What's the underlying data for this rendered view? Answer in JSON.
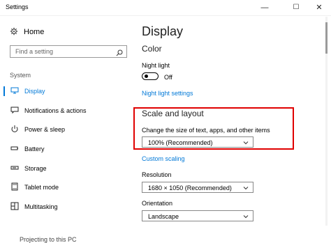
{
  "window": {
    "title": "Settings"
  },
  "sidebar": {
    "home_label": "Home",
    "search_placeholder": "Find a setting",
    "section_label": "System",
    "items": [
      {
        "label": "Display",
        "icon": "monitor-icon",
        "active": true
      },
      {
        "label": "Notifications & actions",
        "icon": "message-icon",
        "active": false
      },
      {
        "label": "Power & sleep",
        "icon": "power-icon",
        "active": false
      },
      {
        "label": "Battery",
        "icon": "battery-icon",
        "active": false
      },
      {
        "label": "Storage",
        "icon": "storage-icon",
        "active": false
      },
      {
        "label": "Tablet mode",
        "icon": "tablet-icon",
        "active": false
      },
      {
        "label": "Multitasking",
        "icon": "multitask-icon",
        "active": false
      }
    ],
    "cut_off_text": "Projecting to this PC"
  },
  "main": {
    "title": "Display",
    "color_heading": "Color",
    "night_light_label": "Night light",
    "night_light_state": "Off",
    "night_light_settings": "Night light settings",
    "scale_heading": "Scale and layout",
    "scale_description": "Change the size of text, apps, and other items",
    "scale_value": "100% (Recommended)",
    "custom_scaling": "Custom scaling",
    "resolution_label": "Resolution",
    "resolution_value": "1680 × 1050 (Recommended)",
    "orientation_label": "Orientation",
    "orientation_value": "Landscape"
  },
  "colors": {
    "accent": "#0078d7",
    "highlight": "#e00000"
  }
}
